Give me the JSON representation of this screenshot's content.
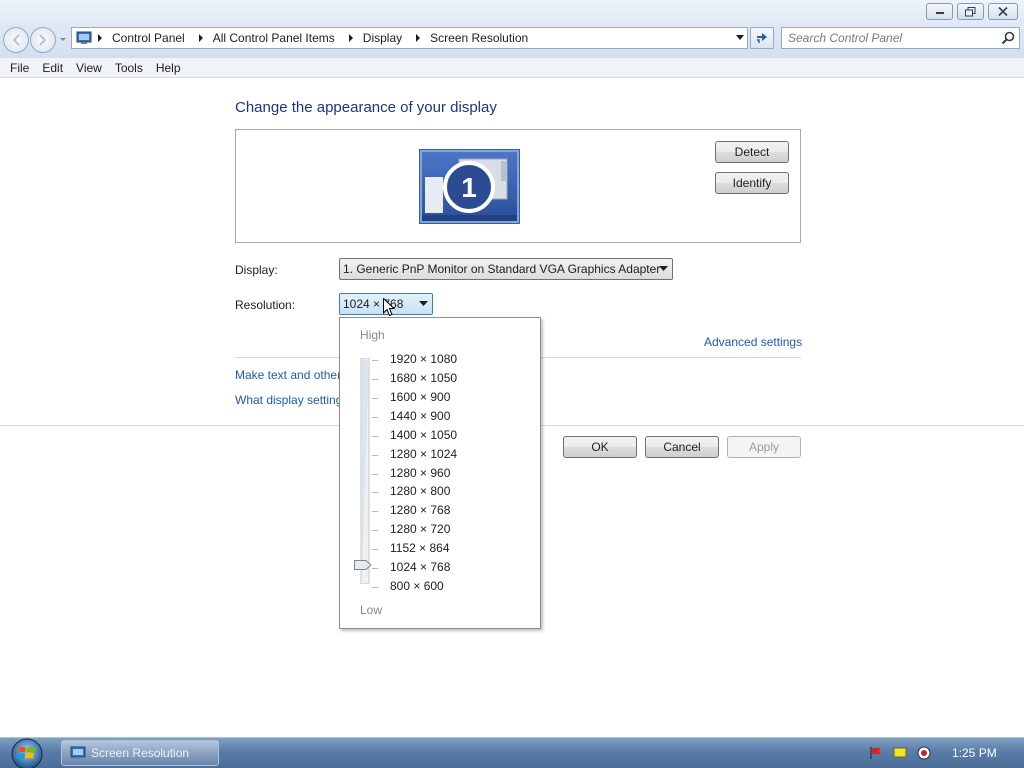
{
  "window": {
    "min_icon": "minimize-icon",
    "max_icon": "restore-icon",
    "close_icon": "close-icon"
  },
  "address_bar": {
    "breadcrumbs": [
      "Control Panel",
      "All Control Panel Items",
      "Display",
      "Screen Resolution"
    ],
    "search_placeholder": "Search Control Panel"
  },
  "menu": [
    "File",
    "Edit",
    "View",
    "Tools",
    "Help"
  ],
  "main": {
    "heading": "Change the appearance of your display",
    "monitor_number": "1",
    "detect_label": "Detect",
    "identify_label": "Identify",
    "display_label": "Display:",
    "display_value": "1. Generic PnP Monitor on Standard VGA Graphics Adapter",
    "resolution_label": "Resolution:",
    "resolution_value": "1024 × 768",
    "advanced_link": "Advanced settings",
    "link_text_size": "Make text and other",
    "link_display_settings": "What display setting",
    "ok_label": "OK",
    "cancel_label": "Cancel",
    "apply_label": "Apply"
  },
  "resolution_dropdown": {
    "high_label": "High",
    "low_label": "Low",
    "options": [
      "1920 × 1080",
      "1680 × 1050",
      "1600 × 900",
      "1440 × 900",
      "1400 × 1050",
      "1280 × 1024",
      "1280 × 960",
      "1280 × 800",
      "1280 × 768",
      "1280 × 720",
      "1152 × 864",
      "1024 × 768",
      "800 × 600"
    ],
    "selected": "1024 × 768"
  },
  "taskbar": {
    "task_label": "Screen Resolution",
    "clock": "1:25 PM"
  },
  "colors": {
    "heading": "#1e3287",
    "link": "#1e5ab4",
    "taskbar": "#5a7ca8"
  }
}
